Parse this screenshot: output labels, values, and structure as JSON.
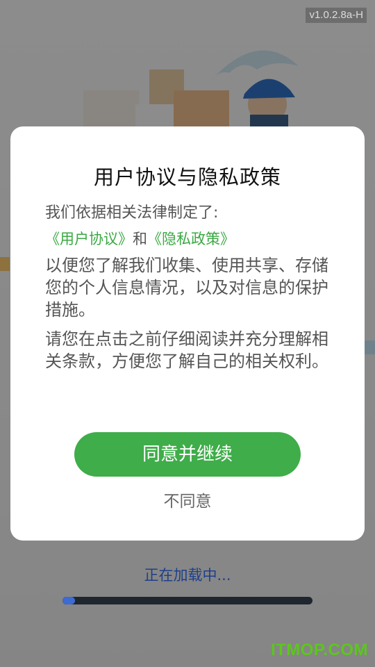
{
  "version_badge": "v1.0.2.8a-H",
  "dialog": {
    "title": "用户协议与隐私政策",
    "intro": "我们依据相关法律制定了:",
    "user_agreement_link": "《用户协议》",
    "and_text": "和",
    "privacy_policy_link": "《隐私政策》",
    "paragraph_1": "以便您了解我们收集、使用共享、存储您的个人信息情况，以及对信息的保护措施。",
    "paragraph_2": "请您在点击之前仔细阅读并充分理解相关条款，方便您了解自己的相关权利。",
    "agree_button": "同意并继续",
    "disagree_button": "不同意"
  },
  "loading": {
    "text": "正在加载中...",
    "progress_fraction": 0.05
  },
  "watermark": "ITMOP.COM",
  "colors": {
    "accent_green": "#3fad49",
    "link_green": "#3aa843",
    "loading_blue": "#1d3f8a",
    "progress_blue": "#3d6bd1"
  },
  "icons": {
    "illustration": "delivery-man-illustration"
  }
}
